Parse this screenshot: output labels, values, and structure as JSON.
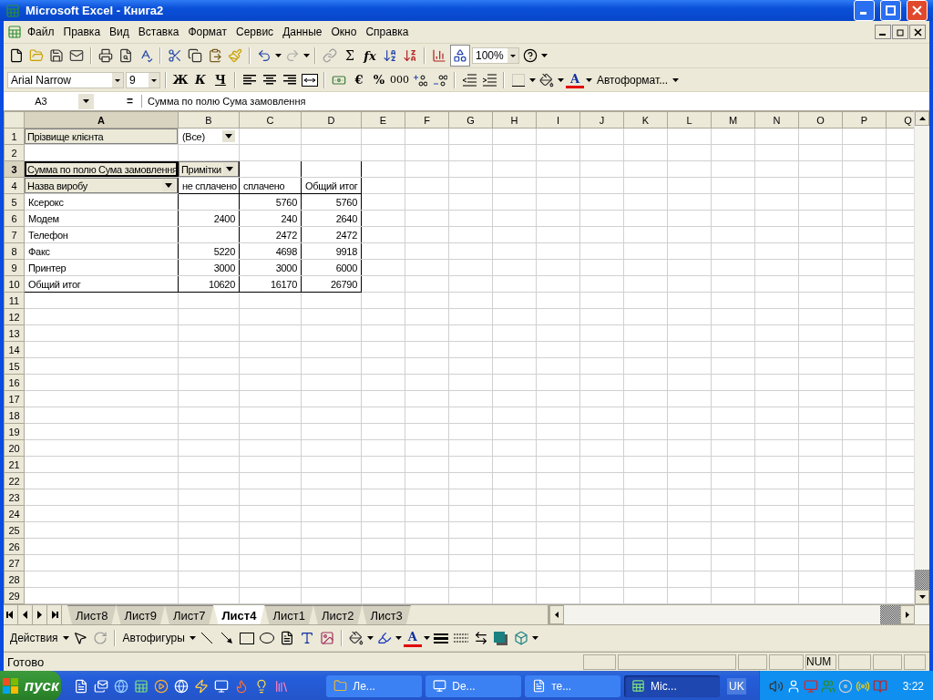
{
  "window": {
    "title": "Microsoft Excel - Книга2"
  },
  "menu": [
    "Файл",
    "Правка",
    "Вид",
    "Вставка",
    "Формат",
    "Сервис",
    "Данные",
    "Окно",
    "Справка"
  ],
  "standard_toolbar": {
    "sum": "Σ",
    "function": "fx",
    "zoom": "100%"
  },
  "formatting_toolbar": {
    "font": "Arial Narrow",
    "size": "9",
    "bold": "Ж",
    "italic": "К",
    "underline": "Ч",
    "euro": "€",
    "percent": "%",
    "thousands": "000",
    "font_color": "A",
    "autoformat": "Автоформат..."
  },
  "formula_bar": {
    "name_box": "A3",
    "equals": "=",
    "formula": "Сумма по полю Сума замовлення"
  },
  "sheet": {
    "columns": [
      {
        "label": "A",
        "selected": true
      },
      {
        "label": "B",
        "selected": false
      },
      {
        "label": "C",
        "selected": false
      },
      {
        "label": "D",
        "selected": false
      },
      {
        "label": "E",
        "selected": false
      },
      {
        "label": "F",
        "selected": false
      },
      {
        "label": "G",
        "selected": false
      },
      {
        "label": "H",
        "selected": false
      },
      {
        "label": "I",
        "selected": false
      },
      {
        "label": "J",
        "selected": false
      },
      {
        "label": "K",
        "selected": false
      },
      {
        "label": "L",
        "selected": false
      },
      {
        "label": "M",
        "selected": false
      },
      {
        "label": "N",
        "selected": false
      },
      {
        "label": "O",
        "selected": false
      },
      {
        "label": "P",
        "selected": false
      },
      {
        "label": "Q",
        "selected": false
      }
    ],
    "rows": [
      {
        "number": "1",
        "selected": false,
        "cells": [
          {
            "text": "Прізвище клієнта",
            "kind": "field"
          },
          {
            "text": "(Все)",
            "kind": "filter"
          }
        ]
      },
      {
        "number": "2",
        "selected": false
      },
      {
        "number": "3",
        "selected": true,
        "pivot": true,
        "cells": [
          {
            "text": "Сумма по полю Сума замовлення",
            "kind": "field",
            "active": true
          },
          {
            "text": "Примітки",
            "kind": "field_menu"
          }
        ]
      },
      {
        "number": "4",
        "selected": false,
        "pivot": true,
        "cells": [
          {
            "text": "Назва виробу",
            "kind": "field_menu"
          },
          {
            "text": "не сплачено",
            "kind": "header"
          },
          {
            "text": "сплачено",
            "kind": "header"
          },
          {
            "text": "Общий итог",
            "kind": "header"
          }
        ]
      },
      {
        "number": "5",
        "selected": false,
        "pivot": true,
        "cells": [
          {
            "text": "Ксерокс",
            "kind": "label"
          },
          null,
          {
            "text": "5760",
            "kind": "number"
          },
          {
            "text": "5760",
            "kind": "number"
          }
        ]
      },
      {
        "number": "6",
        "selected": false,
        "pivot": true,
        "cells": [
          {
            "text": "Модем",
            "kind": "label"
          },
          {
            "text": "2400",
            "kind": "number"
          },
          {
            "text": "240",
            "kind": "number"
          },
          {
            "text": "2640",
            "kind": "number"
          }
        ]
      },
      {
        "number": "7",
        "selected": false,
        "pivot": true,
        "cells": [
          {
            "text": "Телефон",
            "kind": "label"
          },
          null,
          {
            "text": "2472",
            "kind": "number"
          },
          {
            "text": "2472",
            "kind": "number"
          }
        ]
      },
      {
        "number": "8",
        "selected": false,
        "pivot": true,
        "cells": [
          {
            "text": "Факс",
            "kind": "label"
          },
          {
            "text": "5220",
            "kind": "number"
          },
          {
            "text": "4698",
            "kind": "number"
          },
          {
            "text": "9918",
            "kind": "number"
          }
        ]
      },
      {
        "number": "9",
        "selected": false,
        "pivot": true,
        "cells": [
          {
            "text": "Принтер",
            "kind": "label"
          },
          {
            "text": "3000",
            "kind": "number"
          },
          {
            "text": "3000",
            "kind": "number"
          },
          {
            "text": "6000",
            "kind": "number"
          }
        ]
      },
      {
        "number": "10",
        "selected": false,
        "pivot": true,
        "total": true,
        "cells": [
          {
            "text": "Общий итог",
            "kind": "label"
          },
          {
            "text": "10620",
            "kind": "number"
          },
          {
            "text": "16170",
            "kind": "number"
          },
          {
            "text": "26790",
            "kind": "number"
          }
        ]
      },
      {
        "number": "11",
        "selected": false
      },
      {
        "number": "12",
        "selected": false
      },
      {
        "number": "13",
        "selected": false
      },
      {
        "number": "14",
        "selected": false
      },
      {
        "number": "15",
        "selected": false
      },
      {
        "number": "16",
        "selected": false
      },
      {
        "number": "17",
        "selected": false
      },
      {
        "number": "18",
        "selected": false
      },
      {
        "number": "19",
        "selected": false
      },
      {
        "number": "20",
        "selected": false
      },
      {
        "number": "21",
        "selected": false
      },
      {
        "number": "22",
        "selected": false
      },
      {
        "number": "23",
        "selected": false
      },
      {
        "number": "24",
        "selected": false
      },
      {
        "number": "25",
        "selected": false
      },
      {
        "number": "26",
        "selected": false
      },
      {
        "number": "27",
        "selected": false
      },
      {
        "number": "28",
        "selected": false
      },
      {
        "number": "29",
        "selected": false
      }
    ]
  },
  "sheet_tabs": [
    {
      "label": "Лист8",
      "selected": false
    },
    {
      "label": "Лист9",
      "selected": false
    },
    {
      "label": "Лист7",
      "selected": false
    },
    {
      "label": "Лист4",
      "selected": true
    },
    {
      "label": "Лист1",
      "selected": false
    },
    {
      "label": "Лист2",
      "selected": false
    },
    {
      "label": "Лист3",
      "selected": false
    }
  ],
  "drawing_toolbar": {
    "actions": "Действия",
    "autoshapes": "Автофигуры",
    "font_color": "A"
  },
  "status_bar": {
    "status": "Готово",
    "indicator": "NUM"
  },
  "taskbar": {
    "start": "пуск",
    "tasks": [
      {
        "label": "Ле...",
        "kind": "folder",
        "selected": false
      },
      {
        "label": "De...",
        "kind": "window",
        "selected": false
      },
      {
        "label": "те...",
        "kind": "word",
        "selected": false
      },
      {
        "label": "Mic...",
        "kind": "excel",
        "selected": true
      }
    ],
    "language": "UK",
    "clock": "3:22"
  }
}
